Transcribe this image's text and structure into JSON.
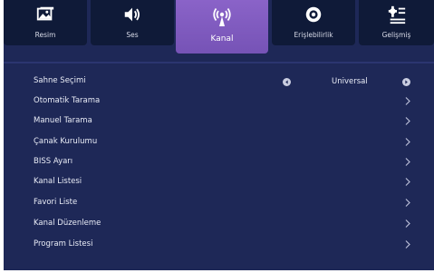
{
  "tabs": [
    {
      "label": "Resim",
      "icon": "picture-icon"
    },
    {
      "label": "Ses",
      "icon": "speaker-icon"
    },
    {
      "label": "Kanal",
      "icon": "broadcast-icon",
      "active": true
    },
    {
      "label": "Erişlebilirlik",
      "icon": "eye-icon"
    },
    {
      "label": "Gelişmiş",
      "icon": "settings-sliders-icon"
    }
  ],
  "menu": {
    "items": [
      {
        "label": "Sahne Seçimi",
        "value": "Universal"
      },
      {
        "label": "Otomatik Tarama"
      },
      {
        "label": "Manuel Tarama"
      },
      {
        "label": "Çanak Kurulumu"
      },
      {
        "label": "BISS Ayarı"
      },
      {
        "label": "Kanal Listesi"
      },
      {
        "label": "Favori Liste"
      },
      {
        "label": "Kanal Düzenleme"
      },
      {
        "label": "Program Listesi"
      }
    ]
  },
  "colors": {
    "background": "#1e2857",
    "tab_background": "#0f1a38",
    "active_tab": "#8a63c8",
    "text": "#e9ecf6"
  }
}
